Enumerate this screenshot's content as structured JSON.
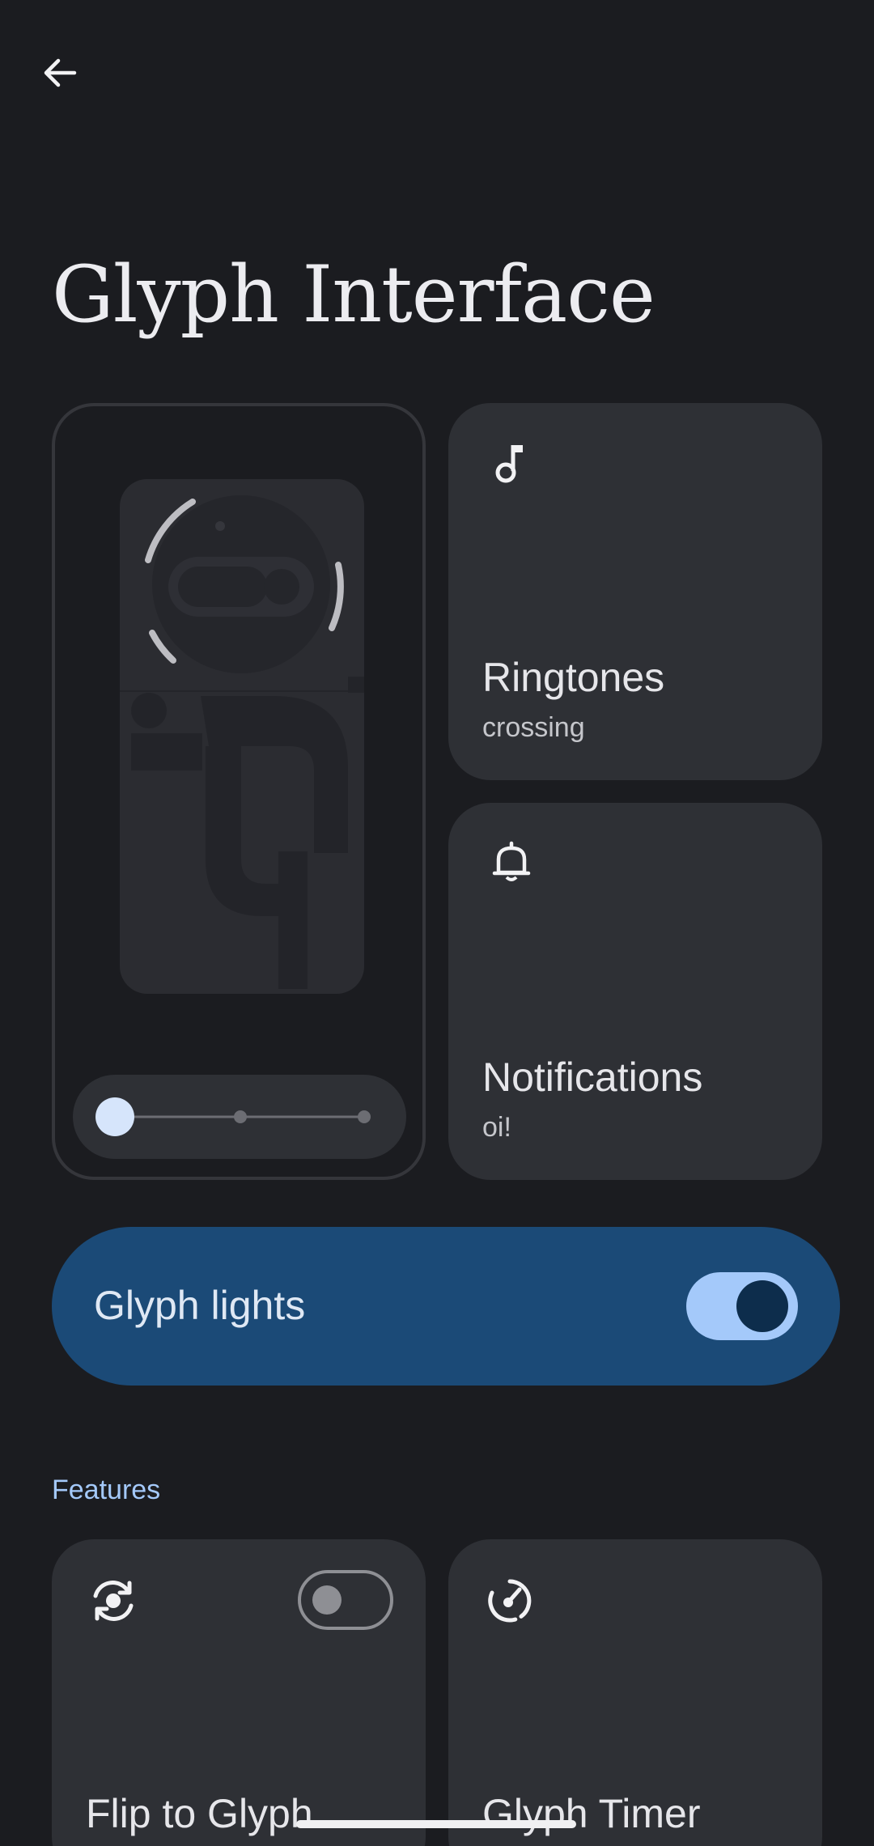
{
  "header": {
    "back_icon": "arrow-back-icon",
    "title": "Glyph Interface"
  },
  "preview": {
    "brightness_level": 0,
    "brightness_steps": 3
  },
  "tiles": {
    "ringtones": {
      "icon": "music-note-icon",
      "title": "Ringtones",
      "subtitle": "crossing"
    },
    "notifications": {
      "icon": "bell-icon",
      "title": "Notifications",
      "subtitle": "oi!"
    }
  },
  "glyph_lights": {
    "label": "Glyph lights",
    "enabled": true
  },
  "features": {
    "header": "Features",
    "items": [
      {
        "icon": "flip-refresh-icon",
        "title": "Flip to Glyph",
        "enabled": false
      },
      {
        "icon": "timer-icon",
        "title": "Glyph Timer"
      }
    ]
  },
  "colors": {
    "background": "#1b1c20",
    "surface": "#2e3035",
    "accent": "#a4c9fa",
    "primary_container": "#1b4a77"
  }
}
